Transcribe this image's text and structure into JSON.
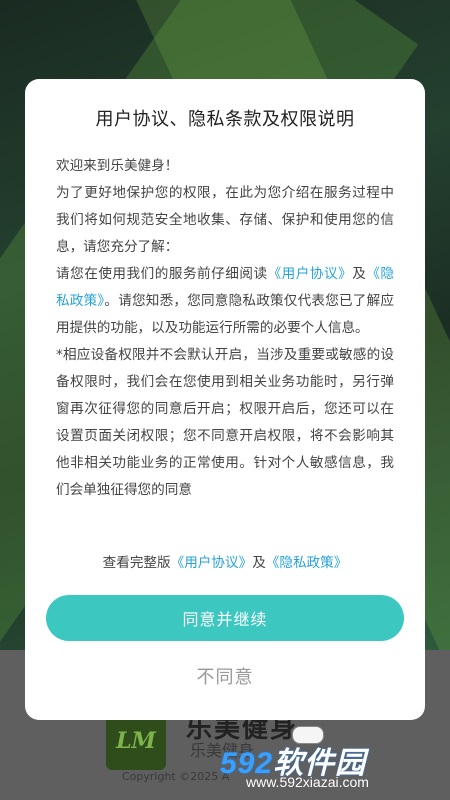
{
  "background_app": {
    "logo_text": "LM",
    "app_name_big": "乐美健身",
    "app_name_small": "乐美健身",
    "copyright": "Copyright ©2025 A"
  },
  "watermark": {
    "digits": "592",
    "text": "软件园",
    "url": "www.592xiazai.com"
  },
  "dialog": {
    "title": "用户协议、隐私条款及权限说明",
    "p1": "欢迎来到乐美健身！",
    "p2": "为了更好地保护您的权限，在此为您介绍在服务过程中我们将如何规范安全地收集、存储、保护和使用您的信息，请您充分了解：",
    "p3_pre": "请您在使用我们的服务前仔细阅读",
    "user_agreement_link": "《用户协议》",
    "and": "及",
    "privacy_policy_link": "《隐私政策》",
    "p3_post": "。请您知悉，您同意隐私政策仅代表您已了解应用提供的功能，以及功能运行所需的必要个人信息。",
    "p4": "*相应设备权限并不会默认开启，当涉及重要或敏感的设备权限时，我们会在您使用到相关业务功能时，另行弹窗再次征得您的同意后开启；权限开启后，您还可以在设置页面关闭权限；您不同意开启权限，将不会影响其他非相关功能业务的正常使用。针对个人敏感信息，我们会单独征得您的同意",
    "full_version_prefix": "查看完整版",
    "agree_button": "同意并继续",
    "disagree_button": "不同意"
  },
  "colors": {
    "accent": "#3cc7c1",
    "link": "#26a3d9"
  }
}
